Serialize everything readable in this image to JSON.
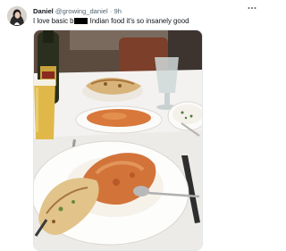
{
  "tweet": {
    "display_name": "Daniel",
    "handle": "@growing_daniel",
    "separator": "·",
    "time": "9h",
    "text_before": "I love basic b",
    "text_after": " Indian food it's so insanely good",
    "more_icon": "more-horizontal-icon"
  },
  "colors": {
    "name": "#0f1419",
    "secondary": "#536471",
    "redaction": "#000000"
  }
}
